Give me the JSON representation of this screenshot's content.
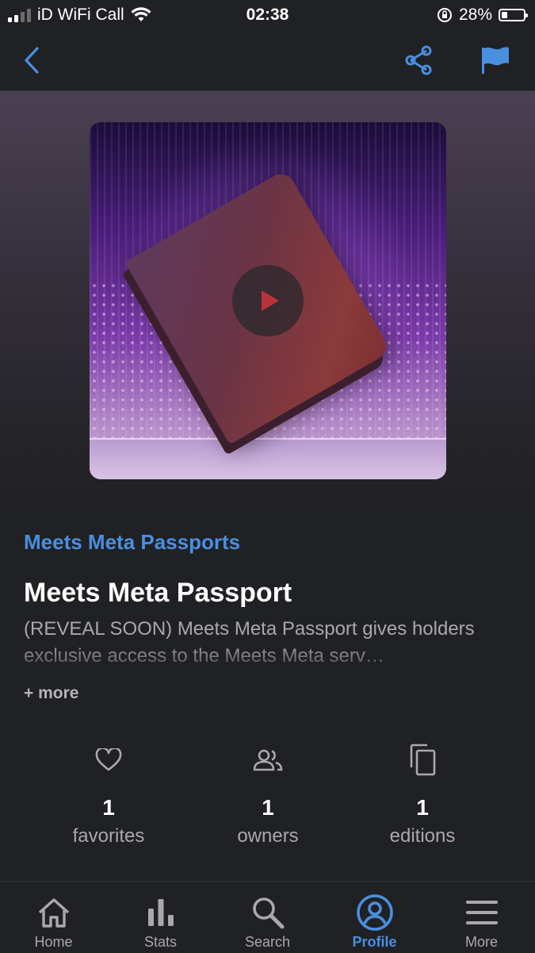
{
  "status_bar": {
    "carrier": "iD WiFi Call",
    "time": "02:38",
    "battery_percent": "28%",
    "battery_level": 0.28
  },
  "nav": {
    "back_icon": "chevron-left-icon",
    "share_icon": "share-icon",
    "flag_icon": "flag-icon",
    "accent_color": "#4a8fe0"
  },
  "item": {
    "collection": "Meets Meta Passports",
    "title": "Meets Meta Passport",
    "description": "(REVEAL SOON) Meets Meta Passport gives holders exclusive access to the Meets Meta serv…",
    "more_label": "+ more"
  },
  "stats": [
    {
      "icon": "heart-icon",
      "value": "1",
      "label": "favorites"
    },
    {
      "icon": "people-icon",
      "value": "1",
      "label": "owners"
    },
    {
      "icon": "copy-icon",
      "value": "1",
      "label": "editions"
    }
  ],
  "tabs": [
    {
      "icon": "home-icon",
      "label": "Home",
      "active": false
    },
    {
      "icon": "stats-icon",
      "label": "Stats",
      "active": false
    },
    {
      "icon": "search-icon",
      "label": "Search",
      "active": false
    },
    {
      "icon": "profile-icon",
      "label": "Profile",
      "active": true
    },
    {
      "icon": "menu-icon",
      "label": "More",
      "active": false
    }
  ]
}
